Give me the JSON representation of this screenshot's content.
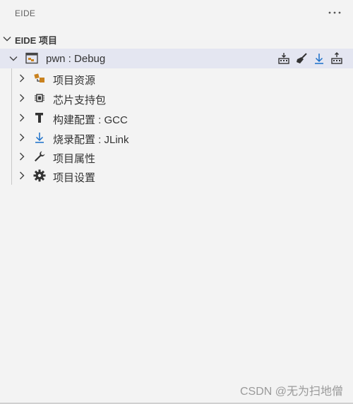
{
  "panel": {
    "title": "EIDE",
    "more_icon": "ellipsis-icon"
  },
  "section": {
    "title": "EIDE 项目",
    "chevron": "chevron-down-icon"
  },
  "project": {
    "label": "pwn : Debug",
    "icon": "project-window-icon",
    "actions": [
      {
        "name": "build-icon"
      },
      {
        "name": "clean-broom-icon"
      },
      {
        "name": "download-icon"
      },
      {
        "name": "rebuild-icon"
      }
    ]
  },
  "tree": {
    "items": [
      {
        "label": "项目资源",
        "icon": "project-resources-icon"
      },
      {
        "label": "芯片支持包",
        "icon": "chip-icon"
      },
      {
        "label": "构建配置 : GCC",
        "icon": "hammer-icon"
      },
      {
        "label": "烧录配置 : JLink",
        "icon": "download-arrow-icon"
      },
      {
        "label": "项目属性",
        "icon": "wrench-icon"
      },
      {
        "label": "项目设置",
        "icon": "gear-icon"
      }
    ]
  },
  "watermark": "CSDN @无为扫地僧",
  "colors": {
    "selected_row": "#e4e6f1",
    "accent_blue": "#1a6fc9",
    "icon_orange": "#c9821f"
  }
}
